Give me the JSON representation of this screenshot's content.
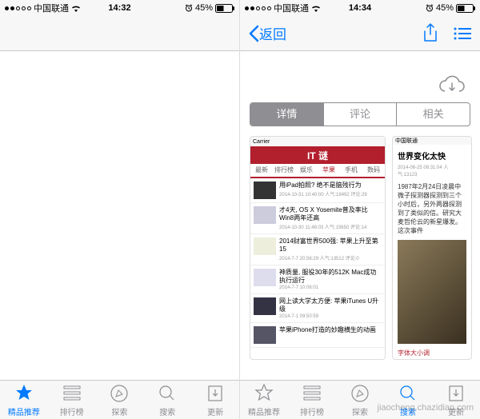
{
  "statusbar": {
    "carrier": "中国联通",
    "time_left": "14:32",
    "time_right": "14:34",
    "battery": "45%"
  },
  "nav": {
    "back": "返回"
  },
  "cloud": {
    "label": ""
  },
  "segments": {
    "detail": "详情",
    "comments": "评论",
    "related": "相关"
  },
  "tabs": {
    "featured": "精品推荐",
    "charts": "排行榜",
    "explore": "探索",
    "search": "搜索",
    "updates": "更新"
  },
  "shot1": {
    "carrier": "Carrier",
    "logo": "IT 谜",
    "nav": {
      "latest": "最新",
      "rank": "排行榜",
      "yule": "娱乐",
      "apple": "苹果",
      "phone": "手机",
      "digital": "数码"
    },
    "items": [
      {
        "title": "用iPad拍照? 绝不是脑残行为",
        "meta": "2014-10-31 10:40:00   人气:19492   评论:29"
      },
      {
        "title": "才4天, OS X Yosemite普及率比Win8两年还高",
        "meta": "2014-10-30 11:46:03   人气:15650   评论:14"
      },
      {
        "title": "2014财富世界500强: 苹果上升至第15",
        "meta": "2014-7-7 20:56:29   人气:13512   评论:0"
      },
      {
        "title": "神质量, 服役30年的512K Mac成功执行运行",
        "meta": "2014-7-7 10:06:01"
      },
      {
        "title": "网上读大学太方便: 苹果iTunes U升级",
        "meta": "2014-7-1 09:50:59"
      },
      {
        "title": "苹果iPhone打造的妙趣横生的动画",
        "meta": ""
      }
    ]
  },
  "shot2": {
    "carrier": "中国联通",
    "title": "世界变化太快",
    "meta": "2014-06-25 08:31:04  人气:13123",
    "body": "1987年2月24日凌晨中微子探测器探测到三个小时后，另外两器探测到了类似的信。研究大麦哲伦云的新星爆发。这次事件",
    "fontlabel": "字体大小调"
  },
  "watermark": "jiaocheng.chazidian.com"
}
